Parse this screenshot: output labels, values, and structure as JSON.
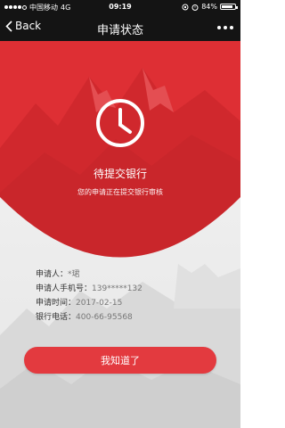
{
  "status_bar": {
    "carrier": "中国移动",
    "network": "4G",
    "time": "09:19",
    "battery": "84%",
    "battery_level": 0.84
  },
  "nav": {
    "back_label": "Back",
    "title": "申请状态"
  },
  "status": {
    "icon": "clock-icon",
    "title": "待提交银行",
    "description": "您的申请正在提交银行审核"
  },
  "info": {
    "applicant_label": "申请人：",
    "applicant_value": "*珺",
    "phone_label": "申请人手机号：",
    "phone_value": "139*****132",
    "date_label": "申请时间：",
    "date_value": "2017-02-15",
    "bank_phone_label": "银行电话：",
    "bank_phone_value": "400-66-95568"
  },
  "actions": {
    "acknowledge_label": "我知道了"
  },
  "colors": {
    "accent": "#e33a3f",
    "bar": "#141414"
  }
}
